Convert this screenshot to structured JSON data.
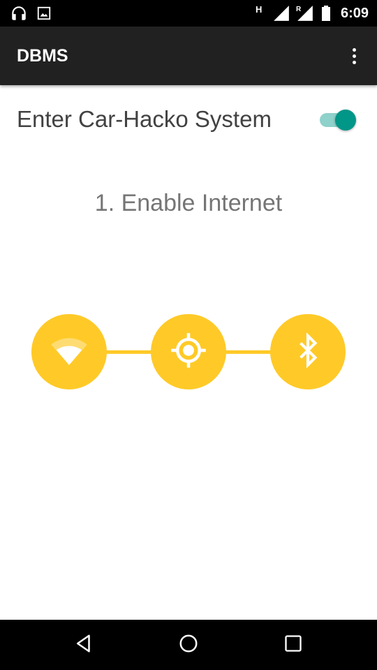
{
  "status_bar": {
    "time": "6:09",
    "network_h_label": "H",
    "roaming_label": "R",
    "icons_left": [
      "headphones-icon",
      "image-icon"
    ],
    "icons_right": [
      "signal-icon",
      "signal-roaming-icon",
      "battery-icon"
    ]
  },
  "app_bar": {
    "title": "DBMS",
    "overflow_icon": "more-vert-icon"
  },
  "main": {
    "switch_label": "Enter Car-Hacko System",
    "switch_on": true,
    "step_heading": "1. Enable Internet",
    "steps": [
      {
        "icon": "wifi-icon"
      },
      {
        "icon": "location-icon"
      },
      {
        "icon": "bluetooth-icon"
      }
    ]
  },
  "nav_bar": {
    "buttons": [
      "back-icon",
      "home-icon",
      "recents-icon"
    ]
  },
  "colors": {
    "accent": "#009688",
    "accent_track": "#8fd1cb",
    "step_yellow": "#ffca28",
    "app_bar": "#212121",
    "text_primary": "#424242",
    "text_secondary": "#757575"
  }
}
